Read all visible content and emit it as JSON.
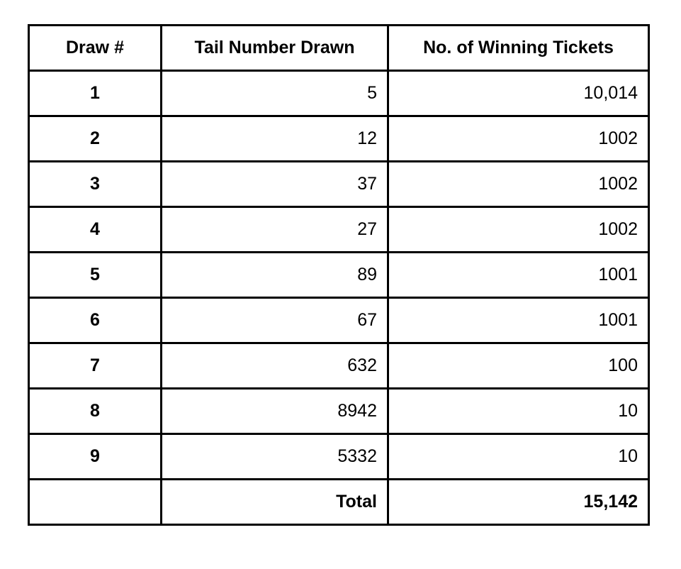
{
  "table": {
    "columns": [
      {
        "key": "draw",
        "label": "Draw #"
      },
      {
        "key": "tail",
        "label": "Tail Number Drawn"
      },
      {
        "key": "tickets",
        "label": "No. of Winning Tickets"
      }
    ],
    "rows": [
      {
        "draw": "1",
        "tail": "5",
        "tickets": "10,014"
      },
      {
        "draw": "2",
        "tail": "12",
        "tickets": "1002"
      },
      {
        "draw": "3",
        "tail": "37",
        "tickets": "1002"
      },
      {
        "draw": "4",
        "tail": "27",
        "tickets": "1002"
      },
      {
        "draw": "5",
        "tail": "89",
        "tickets": "1001"
      },
      {
        "draw": "6",
        "tail": "67",
        "tickets": "1001"
      },
      {
        "draw": "7",
        "tail": "632",
        "tickets": "100"
      },
      {
        "draw": "8",
        "tail": "8942",
        "tickets": "10"
      },
      {
        "draw": "9",
        "tail": "5332",
        "tickets": "10"
      }
    ],
    "total_row": {
      "draw": "",
      "label": "Total",
      "value": "15,142"
    }
  },
  "style": {
    "border_color": "#000000",
    "text_color": "#000000",
    "background": "#ffffff"
  }
}
